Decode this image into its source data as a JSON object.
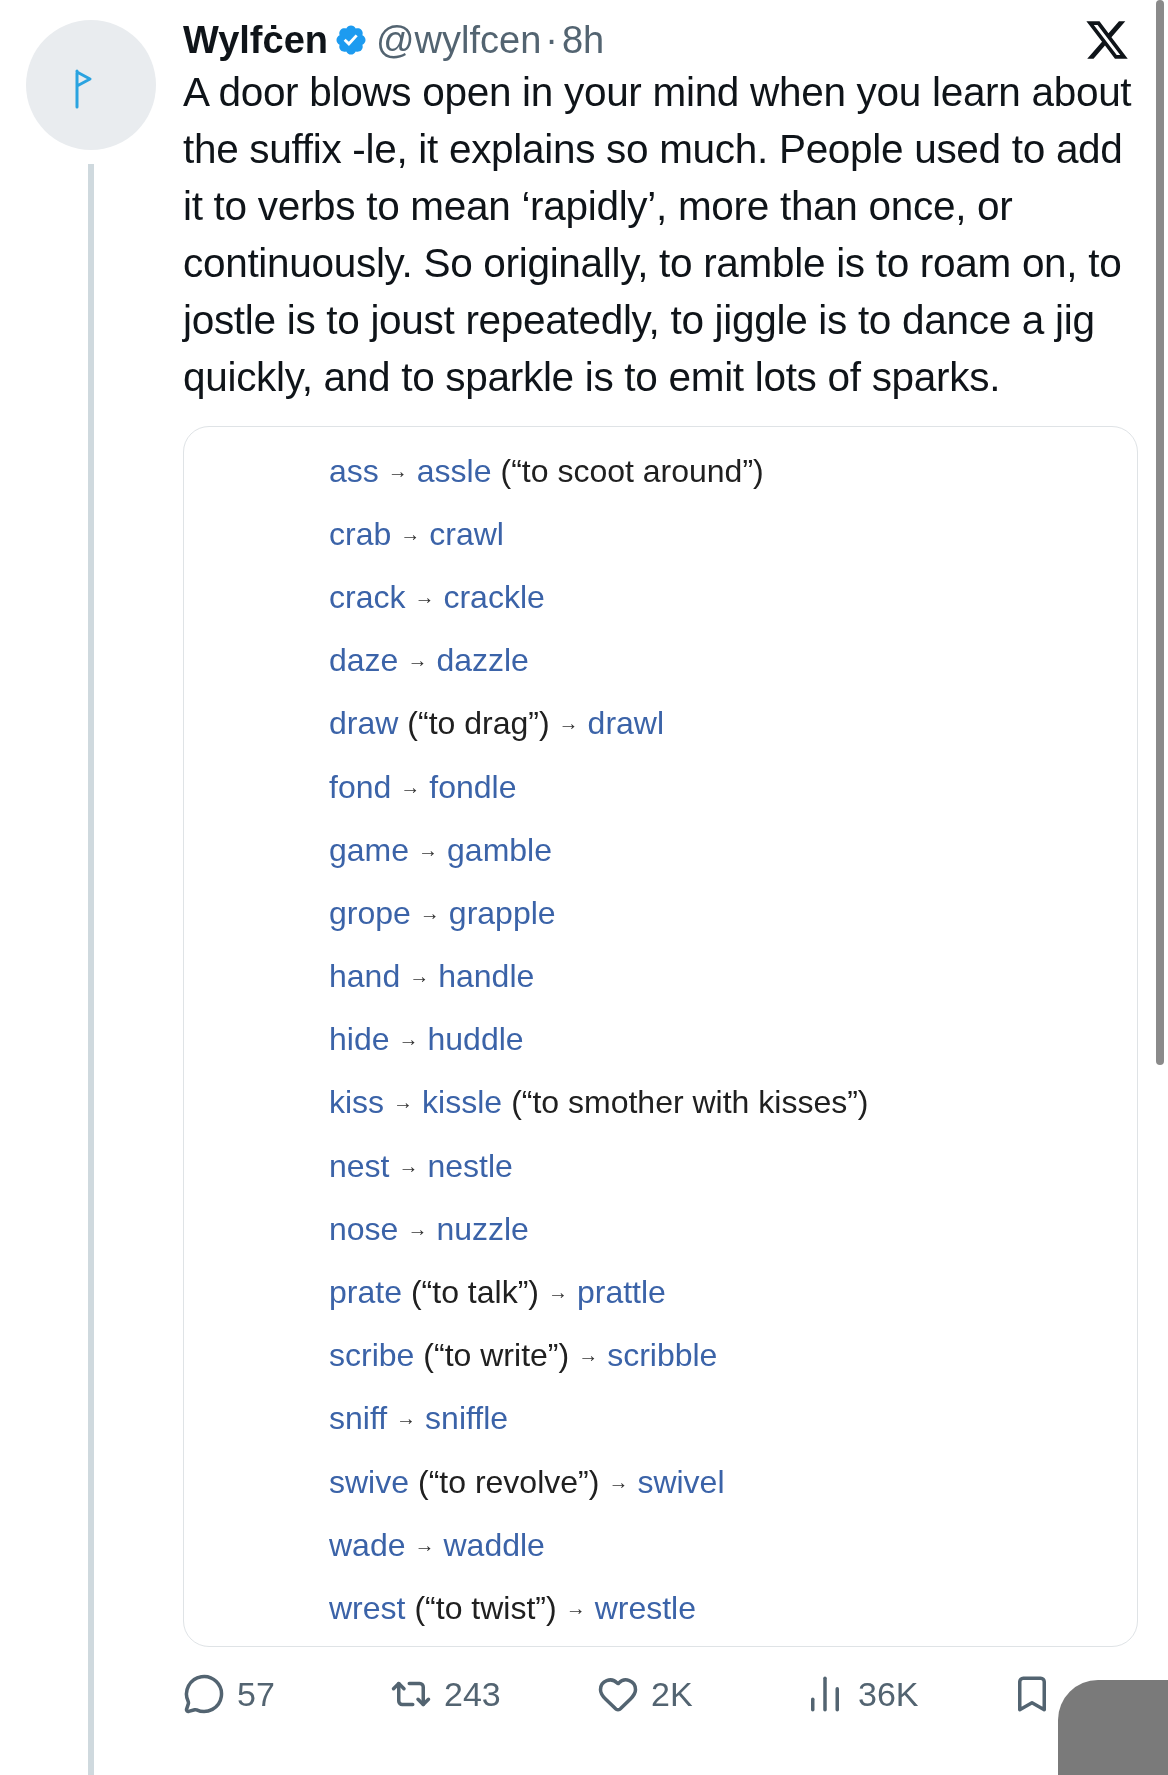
{
  "author": {
    "name": "Wylfċen",
    "handle": "@wylfcen",
    "separator": "·",
    "time": "8h",
    "verified": true
  },
  "text": "A door blows open in your mind when you learn about the suffix -le, it explains so much. People used to add it to verbs to mean ‘rapidly’, more than once, or continuously. So originally, to ramble is to roam on, to jostle is to joust repeatedly, to jiggle is to dance a jig quickly, and to sparkle is to emit lots of sparks.",
  "list": [
    [
      {
        "kind": "word",
        "text": "ass"
      },
      {
        "kind": "arrow",
        "text": "→"
      },
      {
        "kind": "word",
        "text": "assle"
      },
      {
        "kind": "gloss",
        "text": "(“to scoot around”)"
      }
    ],
    [
      {
        "kind": "word",
        "text": "crab"
      },
      {
        "kind": "arrow",
        "text": "→"
      },
      {
        "kind": "word",
        "text": "crawl"
      }
    ],
    [
      {
        "kind": "word",
        "text": "crack"
      },
      {
        "kind": "arrow",
        "text": "→"
      },
      {
        "kind": "word",
        "text": "crackle"
      }
    ],
    [
      {
        "kind": "word",
        "text": "daze"
      },
      {
        "kind": "arrow",
        "text": "→"
      },
      {
        "kind": "word",
        "text": "dazzle"
      }
    ],
    [
      {
        "kind": "word",
        "text": "draw"
      },
      {
        "kind": "gloss",
        "text": "(“to drag”)"
      },
      {
        "kind": "arrow",
        "text": "→"
      },
      {
        "kind": "word",
        "text": "drawl"
      }
    ],
    [
      {
        "kind": "word",
        "text": "fond"
      },
      {
        "kind": "arrow",
        "text": "→"
      },
      {
        "kind": "word",
        "text": "fondle"
      }
    ],
    [
      {
        "kind": "word",
        "text": "game"
      },
      {
        "kind": "arrow",
        "text": "→"
      },
      {
        "kind": "word",
        "text": "gamble"
      }
    ],
    [
      {
        "kind": "word",
        "text": "grope"
      },
      {
        "kind": "arrow",
        "text": "→"
      },
      {
        "kind": "word",
        "text": "grapple"
      }
    ],
    [
      {
        "kind": "word",
        "text": "hand"
      },
      {
        "kind": "arrow",
        "text": "→"
      },
      {
        "kind": "word",
        "text": "handle"
      }
    ],
    [
      {
        "kind": "word",
        "text": "hide"
      },
      {
        "kind": "arrow",
        "text": "→"
      },
      {
        "kind": "word",
        "text": "huddle"
      }
    ],
    [
      {
        "kind": "word",
        "text": "kiss"
      },
      {
        "kind": "arrow",
        "text": "→"
      },
      {
        "kind": "word",
        "text": "kissle"
      },
      {
        "kind": "gloss",
        "text": "(“to smother with kisses”)"
      }
    ],
    [
      {
        "kind": "word",
        "text": "nest"
      },
      {
        "kind": "arrow",
        "text": "→"
      },
      {
        "kind": "word",
        "text": "nestle"
      }
    ],
    [
      {
        "kind": "word",
        "text": "nose"
      },
      {
        "kind": "arrow",
        "text": "→"
      },
      {
        "kind": "word",
        "text": "nuzzle"
      }
    ],
    [
      {
        "kind": "word",
        "text": "prate"
      },
      {
        "kind": "gloss",
        "text": "(“to talk”)"
      },
      {
        "kind": "arrow",
        "text": "→"
      },
      {
        "kind": "word",
        "text": "prattle"
      }
    ],
    [
      {
        "kind": "word",
        "text": "scribe"
      },
      {
        "kind": "gloss",
        "text": "(“to write”)"
      },
      {
        "kind": "arrow",
        "text": "→"
      },
      {
        "kind": "word",
        "text": "scribble"
      }
    ],
    [
      {
        "kind": "word",
        "text": "sniff"
      },
      {
        "kind": "arrow",
        "text": "→"
      },
      {
        "kind": "word",
        "text": "sniffle"
      }
    ],
    [
      {
        "kind": "word",
        "text": "swive"
      },
      {
        "kind": "gloss",
        "text": "(“to revolve”)"
      },
      {
        "kind": "arrow",
        "text": "→"
      },
      {
        "kind": "word",
        "text": "swivel"
      }
    ],
    [
      {
        "kind": "word",
        "text": "wade"
      },
      {
        "kind": "arrow",
        "text": "→"
      },
      {
        "kind": "word",
        "text": "waddle"
      }
    ],
    [
      {
        "kind": "word",
        "text": "wrest"
      },
      {
        "kind": "gloss",
        "text": "(“to twist”)"
      },
      {
        "kind": "arrow",
        "text": "→"
      },
      {
        "kind": "word",
        "text": "wrestle"
      }
    ]
  ],
  "actions": [
    {
      "kind": "reply",
      "count": "57"
    },
    {
      "kind": "repost",
      "count": "243"
    },
    {
      "kind": "like",
      "count": "2K"
    },
    {
      "kind": "views",
      "count": "36K"
    },
    {
      "kind": "bookmark"
    }
  ]
}
